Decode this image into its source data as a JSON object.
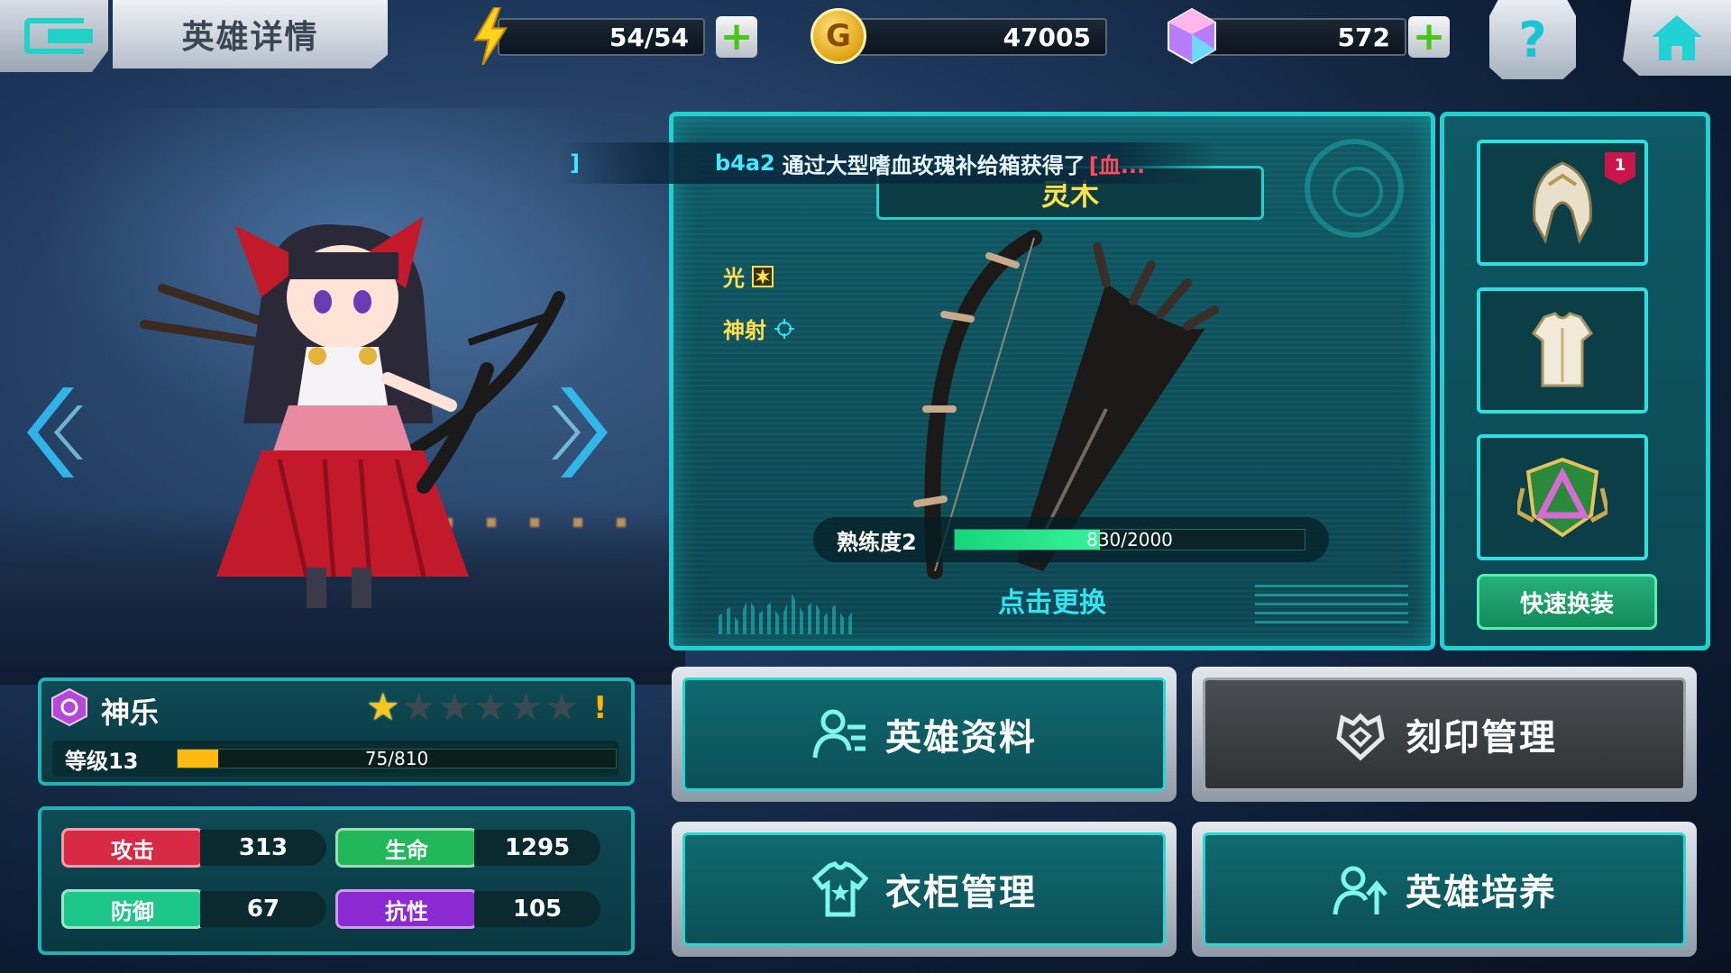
{
  "header": {
    "title": "英雄详情",
    "energy": "54/54",
    "gold": "47005",
    "gems": "572",
    "help_icon": "?"
  },
  "broadcast": {
    "bracket": "]",
    "player": "b4a2",
    "message": "通过大型嗜血玫瑰补给箱获得了",
    "item": "[血..."
  },
  "weapon": {
    "name": "灵木",
    "attributes": [
      {
        "label": "光",
        "icon": "sun-icon"
      },
      {
        "label": "神射",
        "icon": "crosshair-icon"
      }
    ],
    "proficiency_label": "熟练度2",
    "proficiency_text": "830/2000",
    "proficiency_fraction": 0.415,
    "replace_label": "点击更换"
  },
  "equipment": {
    "slots": [
      {
        "icon": "headgear-icon",
        "badge": "1"
      },
      {
        "icon": "armor-icon",
        "badge": ""
      },
      {
        "icon": "emblem-icon",
        "badge": ""
      }
    ],
    "quick_equip_label": "快速换装"
  },
  "hero": {
    "name": "神乐",
    "stars_total": 6,
    "stars_filled": 1,
    "alert": "!",
    "level_label": "等级13",
    "exp_text": "75/810",
    "exp_fraction": 0.0926
  },
  "stats": {
    "attack_label": "攻击",
    "attack": "313",
    "hp_label": "生命",
    "hp": "1295",
    "defense_label": "防御",
    "defense": "67",
    "resist_label": "抗性",
    "resist": "105"
  },
  "menu": {
    "hero_info": "英雄资料",
    "engrave": "刻印管理",
    "wardrobe": "衣柜管理",
    "train": "英雄培养"
  },
  "colors": {
    "accent": "#1fd1cf",
    "attack": "#d92a45",
    "hp": "#22b85a",
    "defense": "#1ec68a",
    "resist": "#8a2ad0",
    "star": "#f7c51d",
    "exp": "#ffb90f",
    "proficiency": "#15d67a"
  }
}
